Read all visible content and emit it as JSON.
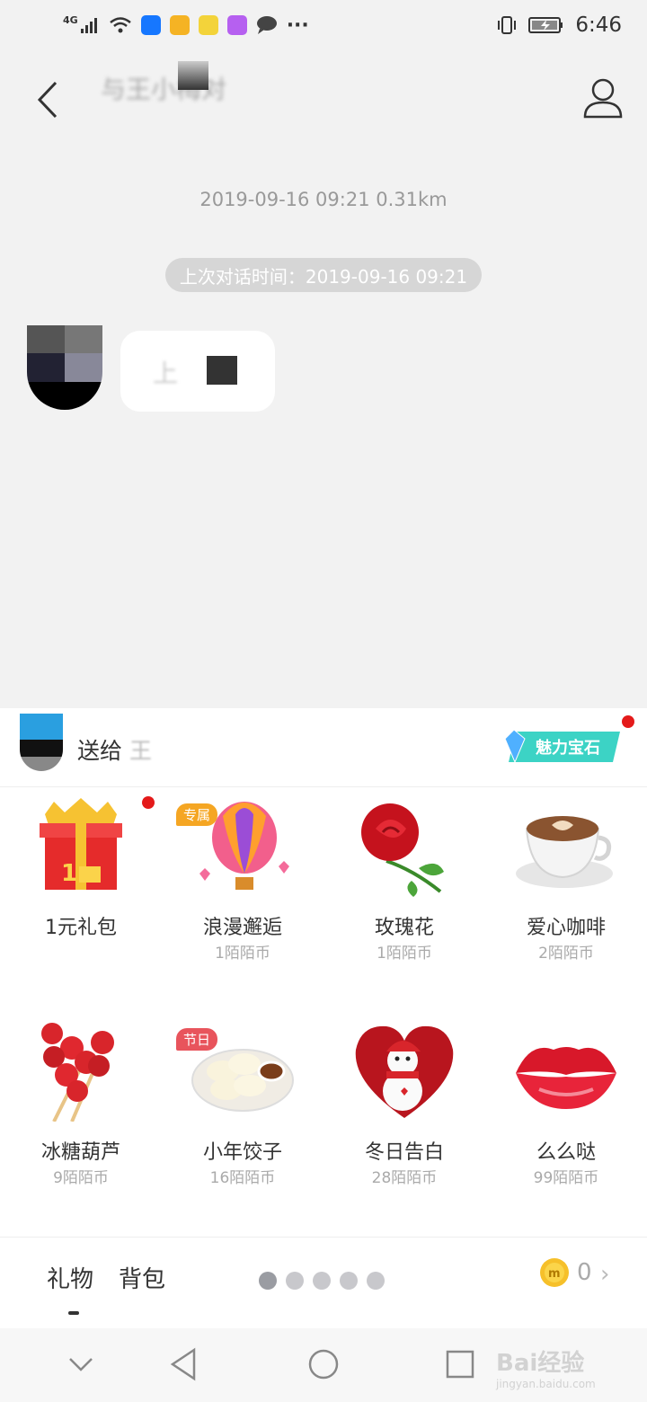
{
  "status_bar": {
    "network": "4G",
    "time": "6:46",
    "more": "···"
  },
  "header": {
    "title": "与王小梅对"
  },
  "chat": {
    "meta": "2019-09-16 09:21  0.31km",
    "last_conversation": "上次对话时间：2019-09-16 09:21",
    "message_text": "上"
  },
  "gift_panel": {
    "send_to_label": "送给",
    "recipient_name": "王",
    "gem_button_label": "魅力宝石",
    "gifts": [
      {
        "name": "1元礼包",
        "price": ""
      },
      {
        "name": "浪漫邂逅",
        "price": "1陌陌币",
        "tag": "专属"
      },
      {
        "name": "玫瑰花",
        "price": "1陌陌币"
      },
      {
        "name": "爱心咖啡",
        "price": "2陌陌币"
      },
      {
        "name": "冰糖葫芦",
        "price": "9陌陌币"
      },
      {
        "name": "小年饺子",
        "price": "16陌陌币",
        "tag": "节日"
      },
      {
        "name": "冬日告白",
        "price": "28陌陌币"
      },
      {
        "name": "么么哒",
        "price": "99陌陌币"
      }
    ],
    "tabs": [
      "礼物",
      "背包"
    ],
    "coin_icon_letter": "m",
    "coin_balance": "0"
  },
  "watermark": {
    "brand": "Bai经验",
    "url": "jingyan.baidu.com"
  },
  "colors": {
    "background": "#f2f2f2",
    "red_dot": "#e41a1a",
    "tag_orange": "#f5a623",
    "tag_red": "#e8545c"
  }
}
